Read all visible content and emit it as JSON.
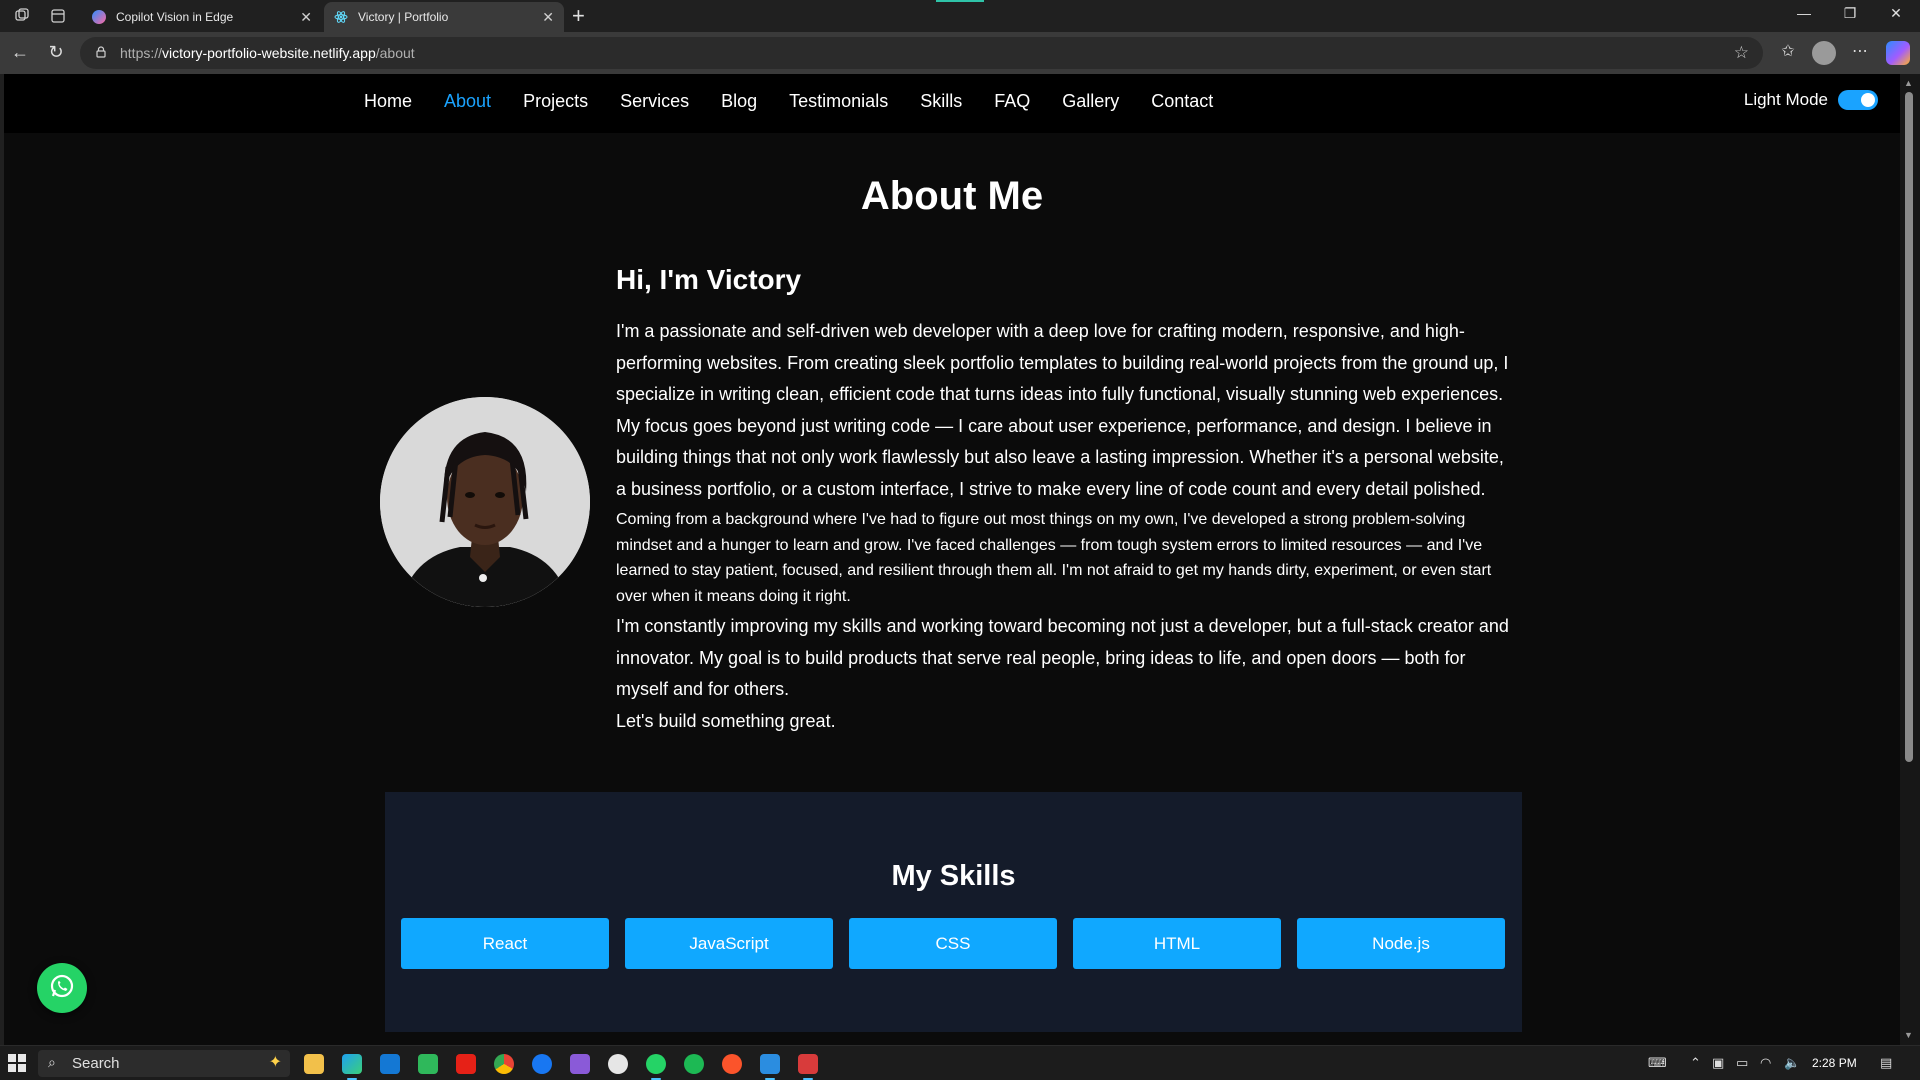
{
  "browser": {
    "tabs": [
      {
        "title": "Copilot Vision in Edge",
        "active": false
      },
      {
        "title": "Victory | Portfolio",
        "active": true
      }
    ],
    "new_tab_label": "+",
    "url_scheme": "https://",
    "url_host": "victory-portfolio-website.netlify.app",
    "url_path": "/about"
  },
  "site": {
    "nav": [
      "Home",
      "About",
      "Projects",
      "Services",
      "Blog",
      "Testimonials",
      "Skills",
      "FAQ",
      "Gallery",
      "Contact"
    ],
    "active_nav": "About",
    "mode_label": "Light Mode",
    "mode_toggle_on": true,
    "page_title": "About Me",
    "greeting": "Hi, I'm Victory",
    "paragraphs": [
      "I'm a passionate and self-driven web developer with a deep love for crafting modern, responsive, and high-performing websites. From creating sleek portfolio templates to building real-world projects from the ground up, I specialize in writing clean, efficient code that turns ideas into fully functional, visually stunning web experiences.",
      "My focus goes beyond just writing code — I care about user experience, performance, and design. I believe in building things that not only work flawlessly but also leave a lasting impression. Whether it's a personal website, a business portfolio, or a custom interface, I strive to make every line of code count and every detail polished.",
      "Coming from a background where I've had to figure out most things on my own, I've developed a strong problem-solving mindset and a hunger to learn and grow. I've faced challenges — from tough system errors to limited resources — and I've learned to stay patient, focused, and resilient through them all. I'm not afraid to get my hands dirty, experiment, or even start over when it means doing it right.",
      "I'm constantly improving my skills and working toward becoming not just a developer, but a full-stack creator and innovator. My goal is to build products that serve real people, bring ideas to life, and open doors — both for myself and for others.",
      "Let's build something great."
    ],
    "skills_title": "My Skills",
    "skills": [
      "React",
      "JavaScript",
      "CSS",
      "HTML",
      "Node.js"
    ]
  },
  "taskbar": {
    "search_placeholder": "Search",
    "time": "2:28 PM"
  },
  "colors": {
    "accent": "#1aa3ff",
    "skill_button": "#10a8ff",
    "skills_panel": "#141b2a",
    "whatsapp": "#25d366"
  }
}
